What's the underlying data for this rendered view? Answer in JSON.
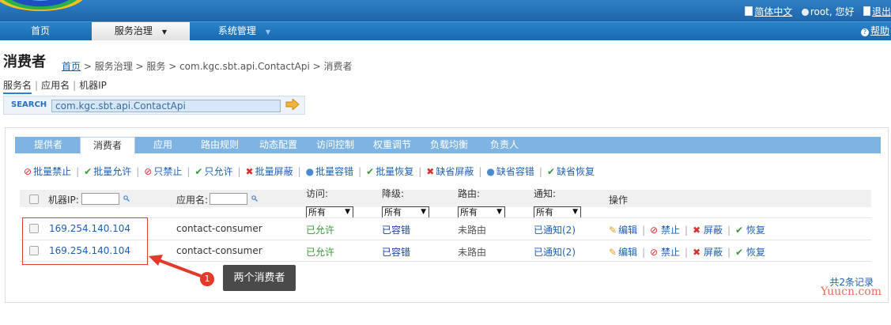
{
  "header": {
    "language": "简体中文",
    "user_greeting": "root, 您好",
    "logout": "退出"
  },
  "nav": {
    "items": [
      {
        "label": "首页"
      },
      {
        "label": "服务治理",
        "caret": "▼"
      },
      {
        "label": "系统管理",
        "caret": "▼"
      }
    ],
    "help": "帮助"
  },
  "page": {
    "title": "消费者",
    "breadcrumb": {
      "home": "首页",
      "rest": " > 服务治理 > 服务 > com.kgc.sbt.api.ContactApi > 消费者"
    }
  },
  "search": {
    "tabs": [
      "服务名",
      "应用名",
      "机器IP"
    ],
    "label": "SEARCH",
    "value": "com.kgc.sbt.api.ContactApi"
  },
  "tabs": [
    "提供者",
    "消费者",
    "应用",
    "路由规则",
    "动态配置",
    "访问控制",
    "权重调节",
    "负载均衡",
    "负责人"
  ],
  "active_tab": "消费者",
  "actions": [
    {
      "label": "批量禁止",
      "icon": "forbid-icon",
      "glyph": "⊘",
      "color": "#d9302c"
    },
    {
      "label": "批量允许",
      "icon": "check-icon",
      "glyph": "✔",
      "color": "#3a9a3a"
    },
    {
      "label": "只禁止",
      "icon": "forbid-icon",
      "glyph": "⊘",
      "color": "#d9302c"
    },
    {
      "label": "只允许",
      "icon": "check-icon",
      "glyph": "✔",
      "color": "#3a9a3a"
    },
    {
      "label": "批量屏蔽",
      "icon": "shield-icon",
      "glyph": "✖",
      "color": "#d9302c"
    },
    {
      "label": "批量容错",
      "icon": "tolerance-icon",
      "glyph": "●",
      "color": "#4a8ad0"
    },
    {
      "label": "批量恢复",
      "icon": "check-icon",
      "glyph": "✔",
      "color": "#3a9a3a"
    },
    {
      "label": "缺省屏蔽",
      "icon": "shield-icon",
      "glyph": "✖",
      "color": "#d9302c"
    },
    {
      "label": "缺省容错",
      "icon": "tolerance-icon",
      "glyph": "●",
      "color": "#4a8ad0"
    },
    {
      "label": "缺省恢复",
      "icon": "check-icon",
      "glyph": "✔",
      "color": "#3a9a3a"
    }
  ],
  "table": {
    "headers": {
      "ip": "机器IP:",
      "app": "应用名:",
      "access": "访问:",
      "degrade": "降级:",
      "route": "路由:",
      "notify": "通知:",
      "ops": "操作"
    },
    "filter_default": "所有",
    "rows": [
      {
        "ip": "169.254.140.104",
        "app": "contact-consumer",
        "access": "已允许",
        "degrade": "已容错",
        "route": "未路由",
        "notify": "已通知(2)"
      },
      {
        "ip": "169.254.140.104",
        "app": "contact-consumer",
        "access": "已允许",
        "degrade": "已容错",
        "route": "未路由",
        "notify": "已通知(2)"
      }
    ],
    "row_ops": {
      "edit": "编辑",
      "forbid": "禁止",
      "shield": "屏蔽",
      "recover": "恢复"
    },
    "record_count": "共2条记录"
  },
  "annotation": {
    "number": "1",
    "label": "两个消费者"
  },
  "watermark": "Yuucn.com",
  "colors": {
    "nav_blue": "#1f64a8",
    "tab_blue": "#7fb4e2",
    "link_blue": "#2060b0",
    "danger_red": "#d9302c",
    "ok_green": "#3a9a3a",
    "callout_red": "#e23a2a"
  }
}
